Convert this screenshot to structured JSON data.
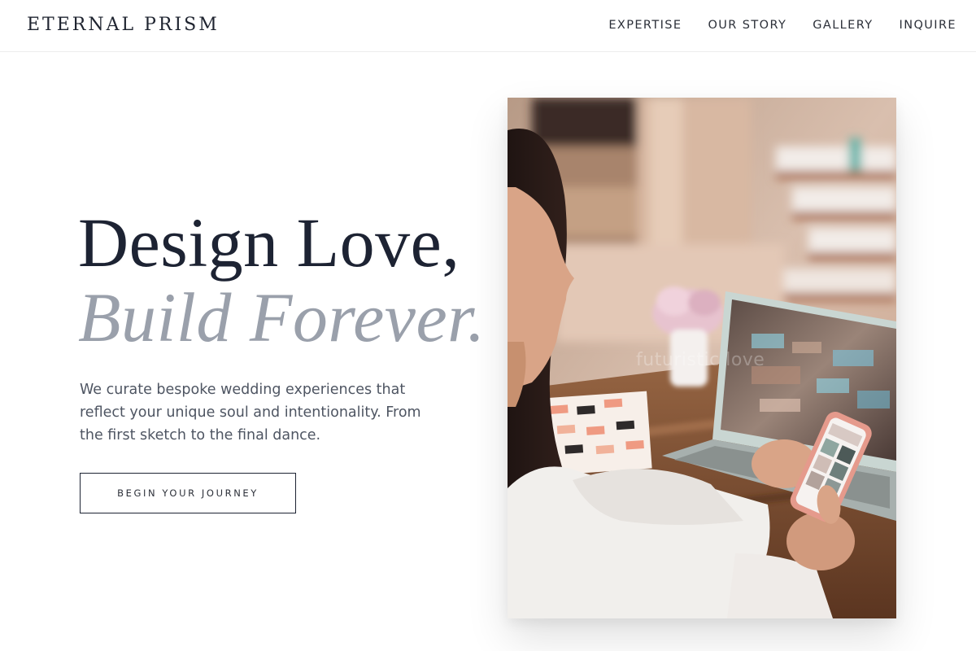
{
  "header": {
    "logo": "ETERNAL PRISM",
    "nav": [
      {
        "label": "EXPERTISE"
      },
      {
        "label": "OUR STORY"
      },
      {
        "label": "GALLERY"
      },
      {
        "label": "INQUIRE"
      }
    ]
  },
  "hero": {
    "headline_line1": "Design Love,",
    "headline_line2": "Build Forever.",
    "intro": "We curate bespoke wedding experiences that reflect your unique soul and intentionality. From the first sketch to the final dance.",
    "cta_label": "BEGIN YOUR JOURNEY",
    "image": {
      "subject": "woman at desk holding a phone in front of a laptop, with flowers and a notebook",
      "watermark": "futuristic love"
    }
  },
  "colors": {
    "headline_dark": "#1d2333",
    "headline_muted": "#9aa0ab",
    "body_text": "#4e5562",
    "background": "#ffffff"
  }
}
